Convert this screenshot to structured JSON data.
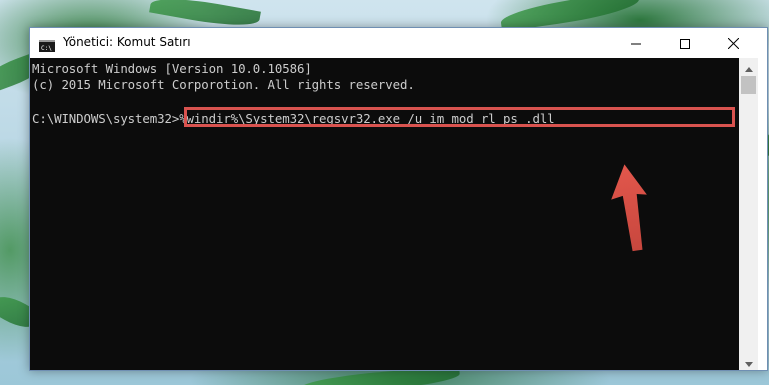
{
  "window": {
    "title": "Yönetici: Komut Satırı",
    "controls": {
      "minimize_icon": "minimize-icon",
      "maximize_icon": "maximize-icon",
      "close_icon": "close-icon"
    }
  },
  "console": {
    "lines": [
      "Microsoft Windows [Version 10.0.10586]",
      "(c) 2015 Microsoft Corporotion. All rights reserved.",
      "C:\\WINDOWS\\system32>%windir%\\System32\\regsvr32.exe /u im_mod_rl_ps_.dll"
    ]
  },
  "annotation": {
    "highlight_color": "#d9534f",
    "arrow_icon": "red-arrow-up-icon"
  },
  "colors": {
    "console_background": "#0c0c0c",
    "console_text": "#cccccc"
  }
}
